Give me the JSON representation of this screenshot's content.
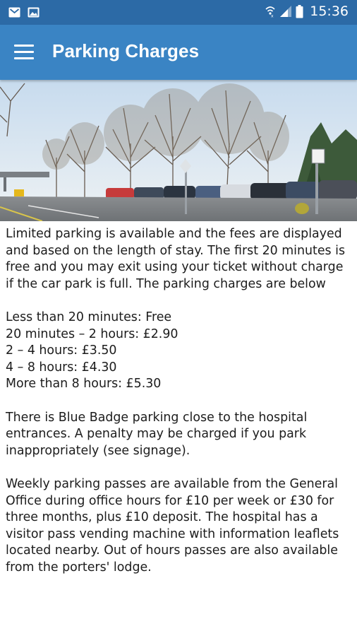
{
  "status_bar": {
    "time": "15:36",
    "left_icons": [
      "mail-icon",
      "image-icon"
    ],
    "right_icons": [
      "wifi-icon",
      "signal-icon",
      "battery-icon"
    ]
  },
  "app_bar": {
    "title": "Parking Charges",
    "menu_icon": "hamburger-menu-icon"
  },
  "hero_image": {
    "description_icon": "car-park-photo"
  },
  "content": {
    "intro": "Limited parking is available and the fees are displayed and based on the length of stay. The first 20 minutes is free and you may exit using your ticket without charge if the car park is full. The parking charges are below",
    "charges": [
      "Less than 20 minutes: Free",
      "20 minutes – 2 hours: £2.90",
      "2 – 4 hours: £3.50",
      "4 – 8 hours: £4.30",
      "More than 8 hours: £5.30"
    ],
    "blue_badge": "There is Blue Badge parking close to the hospital entrances. A penalty may be charged if you park inappropriately (see signage).",
    "weekly_passes": "Weekly parking passes are available from the General Office during office hours for £10 per week or £30 for three months, plus £10 deposit. The hospital has a visitor pass vending machine with information leaflets located nearby. Out of hours passes are also available from the porters' lodge."
  },
  "colors": {
    "status_bar": "#2c6aa6",
    "app_bar": "#3a84c4",
    "text": "#1c1c1c"
  }
}
